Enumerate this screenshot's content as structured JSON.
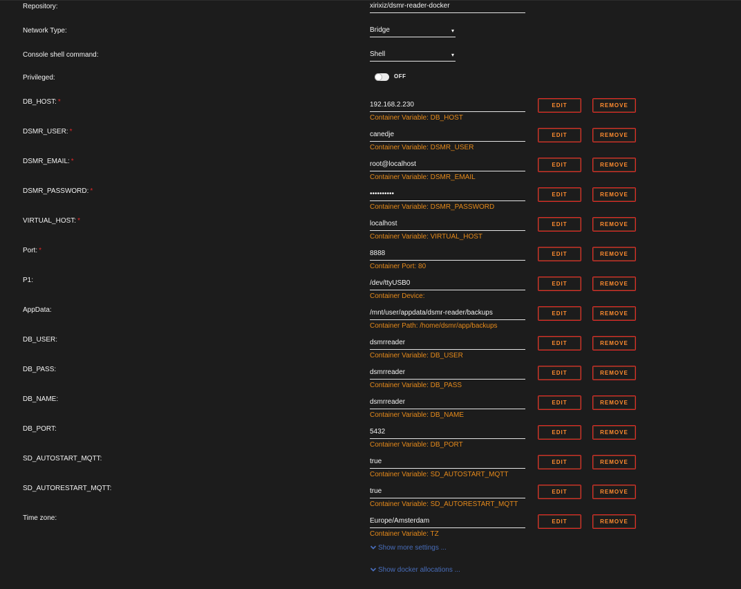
{
  "settings": {
    "repository": {
      "label": "Repository:",
      "value": "xirixiz/dsmr-reader-docker"
    },
    "network_type": {
      "label": "Network Type:",
      "value": "Bridge"
    },
    "console_shell": {
      "label": "Console shell command:",
      "value": "Shell"
    },
    "privileged": {
      "label": "Privileged:",
      "state": "OFF"
    }
  },
  "rows": [
    {
      "label": "DB_HOST:",
      "required": true,
      "value": "192.168.2.230",
      "hint": "Container Variable: DB_HOST"
    },
    {
      "label": "DSMR_USER:",
      "required": true,
      "value": "canedje",
      "hint": "Container Variable: DSMR_USER"
    },
    {
      "label": "DSMR_EMAIL:",
      "required": true,
      "value": "root@localhost",
      "hint": "Container Variable: DSMR_EMAIL"
    },
    {
      "label": "DSMR_PASSWORD:",
      "required": true,
      "value": "••••••••••",
      "hint": "Container Variable: DSMR_PASSWORD"
    },
    {
      "label": "VIRTUAL_HOST:",
      "required": true,
      "value": "localhost",
      "hint": "Container Variable: VIRTUAL_HOST"
    },
    {
      "label": "Port:",
      "required": true,
      "value": "8888",
      "hint": "Container Port: 80"
    },
    {
      "label": "P1:",
      "required": false,
      "value": "/dev/ttyUSB0",
      "hint": "Container Device:"
    },
    {
      "label": "AppData:",
      "required": false,
      "value": "/mnt/user/appdata/dsmr-reader/backups",
      "hint": "Container Path: /home/dsmr/app/backups"
    },
    {
      "label": "DB_USER:",
      "required": false,
      "value": "dsmrreader",
      "hint": "Container Variable: DB_USER"
    },
    {
      "label": "DB_PASS:",
      "required": false,
      "value": "dsmrreader",
      "hint": "Container Variable: DB_PASS"
    },
    {
      "label": "DB_NAME:",
      "required": false,
      "value": "dsmrreader",
      "hint": "Container Variable: DB_NAME"
    },
    {
      "label": "DB_PORT:",
      "required": false,
      "value": "5432",
      "hint": "Container Variable: DB_PORT"
    },
    {
      "label": "SD_AUTOSTART_MQTT:",
      "required": false,
      "value": "true",
      "hint": "Container Variable: SD_AUTOSTART_MQTT"
    },
    {
      "label": "SD_AUTORESTART_MQTT:",
      "required": false,
      "value": "true",
      "hint": "Container Variable: SD_AUTORESTART_MQTT"
    },
    {
      "label": "Time zone:",
      "required": false,
      "value": "Europe/Amsterdam",
      "hint": "Container Variable: TZ"
    }
  ],
  "buttons": {
    "edit": "EDIT",
    "remove": "REMOVE"
  },
  "required_marker": "*",
  "caret": "▾",
  "links": {
    "more_settings": "Show more settings ...",
    "docker_allocations": "Show docker allocations ..."
  },
  "colors": {
    "background": "#1c1c1c",
    "hint": "#e68a1a",
    "button_border": "#e22828",
    "button_text": "#ff8c2f",
    "link": "#486dba",
    "required": "#e22828"
  }
}
